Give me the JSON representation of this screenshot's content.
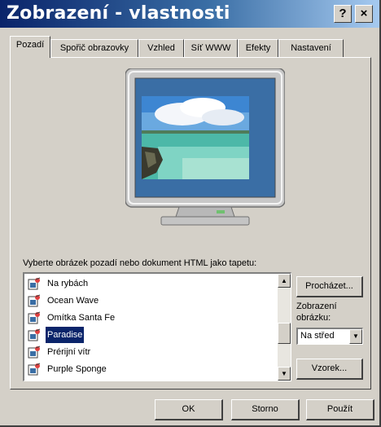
{
  "window": {
    "title": "Zobrazení - vlastnosti",
    "help_label": "?",
    "close_label": "×"
  },
  "tabs": [
    {
      "label": "Pozadí",
      "active": true
    },
    {
      "label": "Spořič obrazovky"
    },
    {
      "label": "Vzhled"
    },
    {
      "label": "Síť WWW"
    },
    {
      "label": "Efekty"
    },
    {
      "label": "Nastavení"
    }
  ],
  "wallpaper": {
    "list_label": "Vyberte obrázek pozadí nebo dokument HTML jako tapetu:",
    "items": [
      {
        "label": "Na rybách",
        "icon": "bmp-file-icon"
      },
      {
        "label": "Ocean Wave",
        "icon": "bmp-file-icon"
      },
      {
        "label": "Omítka Santa Fe",
        "icon": "bmp-file-icon"
      },
      {
        "label": "Paradise",
        "icon": "bmp-file-icon",
        "selected": true
      },
      {
        "label": "Prérijní vítr",
        "icon": "bmp-file-icon"
      },
      {
        "label": "Purple Sponge",
        "icon": "bmp-file-icon"
      }
    ],
    "browse_label": "Procházet...",
    "display_label_line1": "Zobrazení",
    "display_label_line2": "obrázku:",
    "display_value": "Na střed",
    "pattern_label": "Vzorek..."
  },
  "footer": {
    "ok_label": "OK",
    "cancel_label": "Storno",
    "apply_label": "Použít"
  },
  "colors": {
    "titlebar_start": "#0a246a",
    "titlebar_end": "#a6caf0",
    "face": "#d4d0c8",
    "selection": "#0a246a",
    "desktop": "#3a6ea5"
  }
}
